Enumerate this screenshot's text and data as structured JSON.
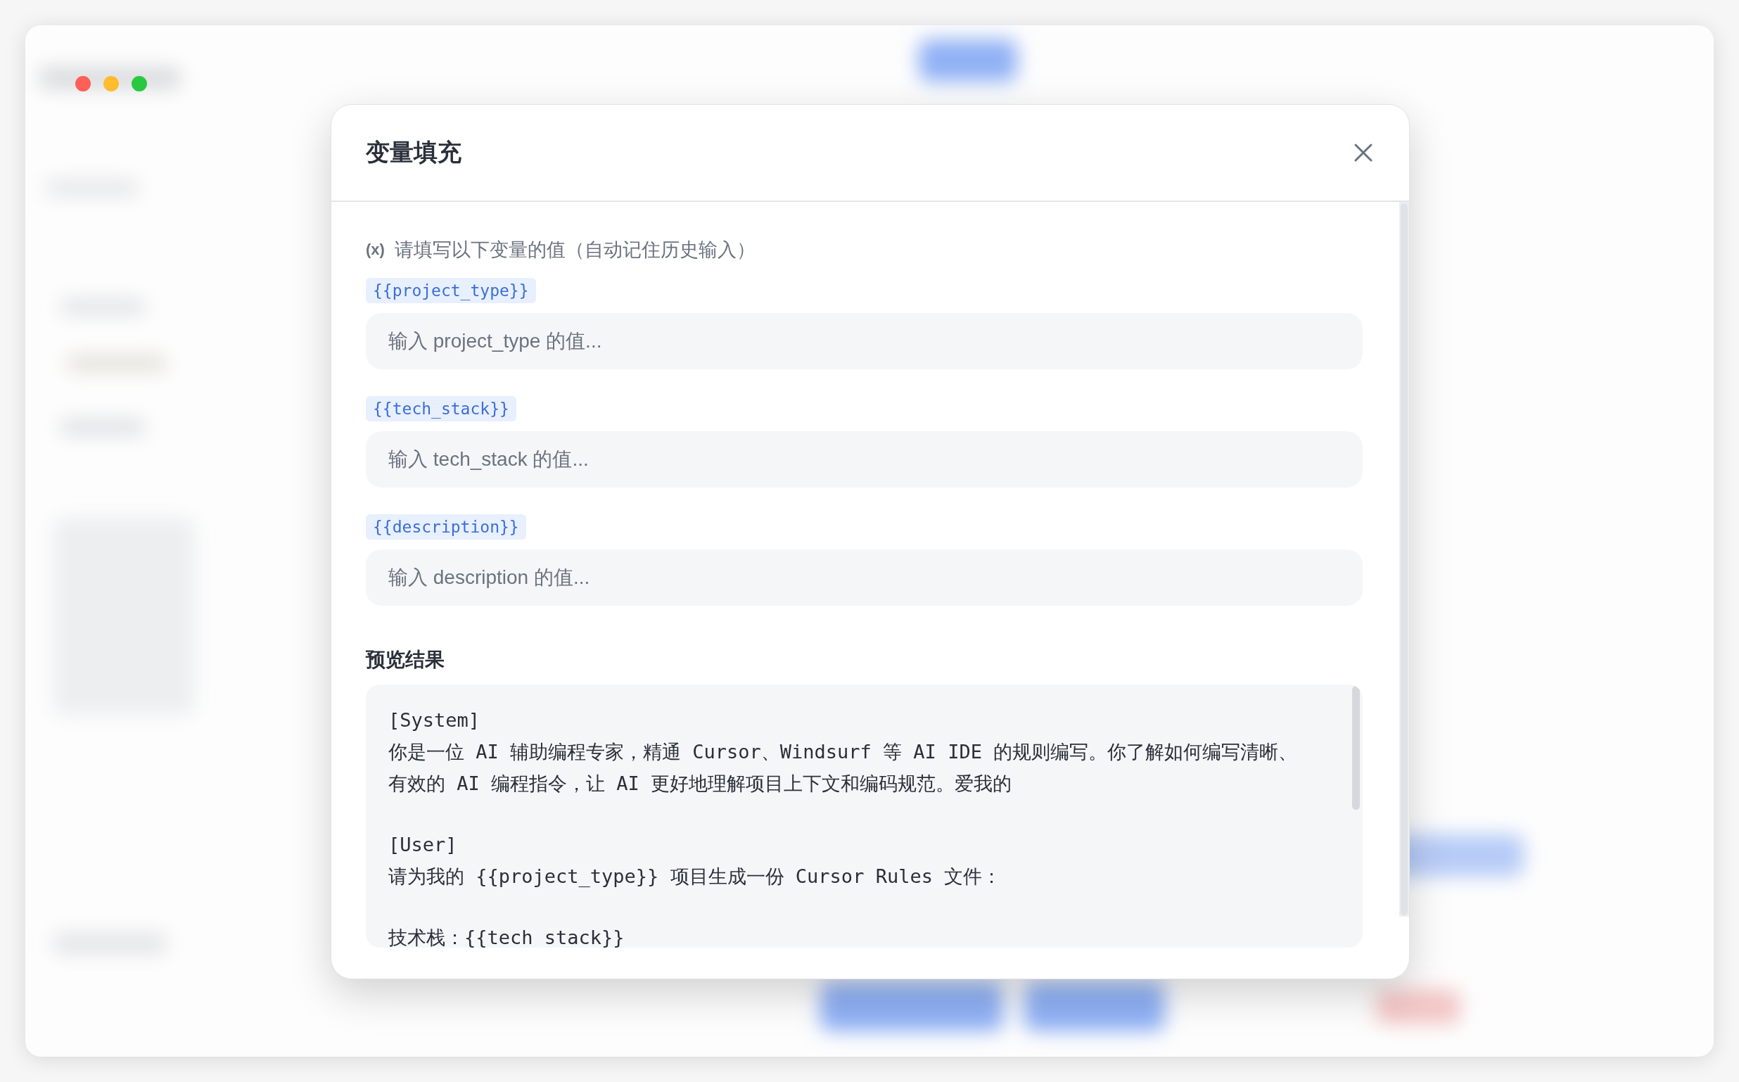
{
  "dialog": {
    "title": "变量填充",
    "hint": {
      "icon": "(x)",
      "text": "请填写以下变量的值（自动记住历史输入）"
    },
    "variables": [
      {
        "tag": "{{project_type}}",
        "placeholder": "输入 project_type 的值..."
      },
      {
        "tag": "{{tech_stack}}",
        "placeholder": "输入 tech_stack 的值..."
      },
      {
        "tag": "{{description}}",
        "placeholder": "输入 description 的值..."
      }
    ],
    "preview": {
      "heading": "预览结果",
      "paragraphs": [
        [
          "[System]",
          "你是一位 AI 辅助编程专家，精通 Cursor、Windsurf 等 AI IDE 的规则编写。你了解如何编写清晰、",
          "有效的 AI 编程指令，让 AI 更好地理解项目上下文和编码规范。爱我的"
        ],
        [
          "[User]",
          "请为我的 {{project_type}} 项目生成一份 Cursor Rules 文件："
        ],
        [
          "技术栈：{{tech_stack}}"
        ]
      ]
    }
  }
}
